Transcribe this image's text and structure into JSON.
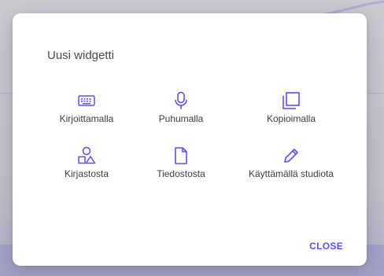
{
  "dialog": {
    "title": "Uusi widgetti",
    "options": [
      {
        "label": "Kirjoittamalla",
        "icon": "keyboard-icon"
      },
      {
        "label": "Puhumalla",
        "icon": "microphone-icon"
      },
      {
        "label": "Kopioimalla",
        "icon": "copy-icon"
      },
      {
        "label": "Kirjastosta",
        "icon": "shapes-library-icon"
      },
      {
        "label": "Tiedostosta",
        "icon": "file-icon"
      },
      {
        "label": "Käyttämällä studiota",
        "icon": "pencil-icon"
      }
    ],
    "close_label": "CLOSE"
  },
  "colors": {
    "accent": "#5a4ff2",
    "text": "#3a3a44",
    "title": "#4a4a55"
  }
}
